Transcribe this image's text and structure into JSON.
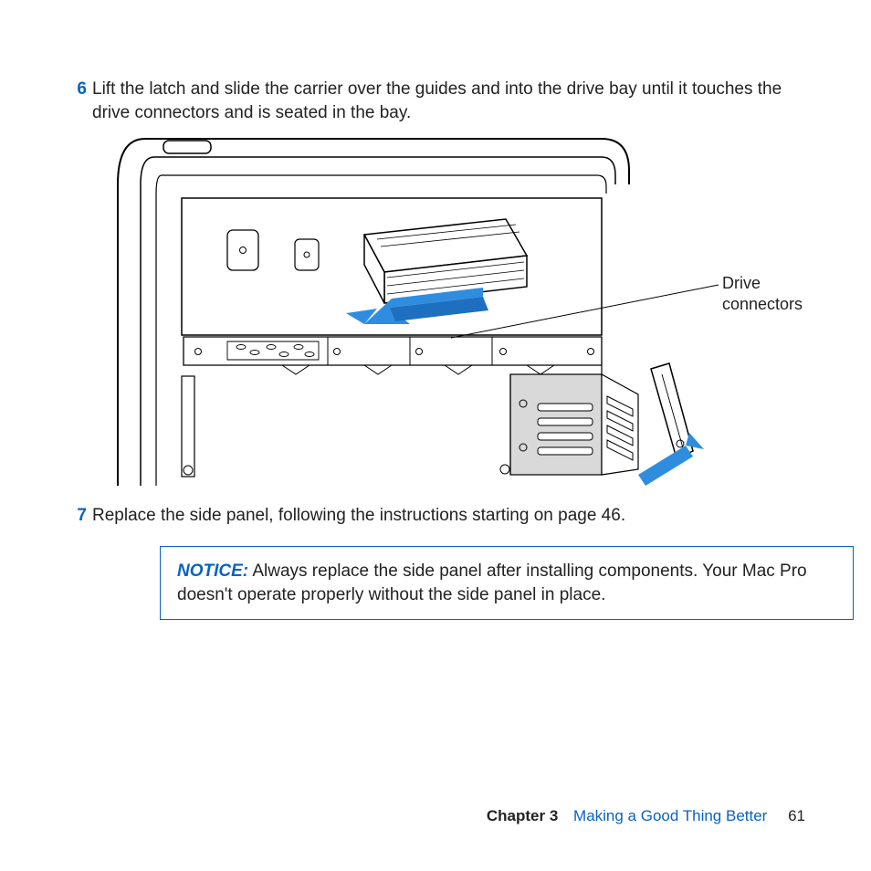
{
  "steps": {
    "s6": {
      "num": "6",
      "text": "Lift the latch and slide the carrier over the guides and into the drive bay until it touches the drive connectors and is seated in the bay."
    },
    "s7": {
      "num": "7",
      "text": "Replace the side panel, following the instructions starting on page 46."
    }
  },
  "callout": {
    "line1": "Drive",
    "line2": "connectors"
  },
  "notice": {
    "label": "NOTICE:",
    "text": "  Always replace the side panel after installing components. Your Mac Pro doesn't operate properly without the side panel in place."
  },
  "footer": {
    "chapter_label": "Chapter 3",
    "chapter_title": "Making a Good Thing Better",
    "page": "61"
  }
}
